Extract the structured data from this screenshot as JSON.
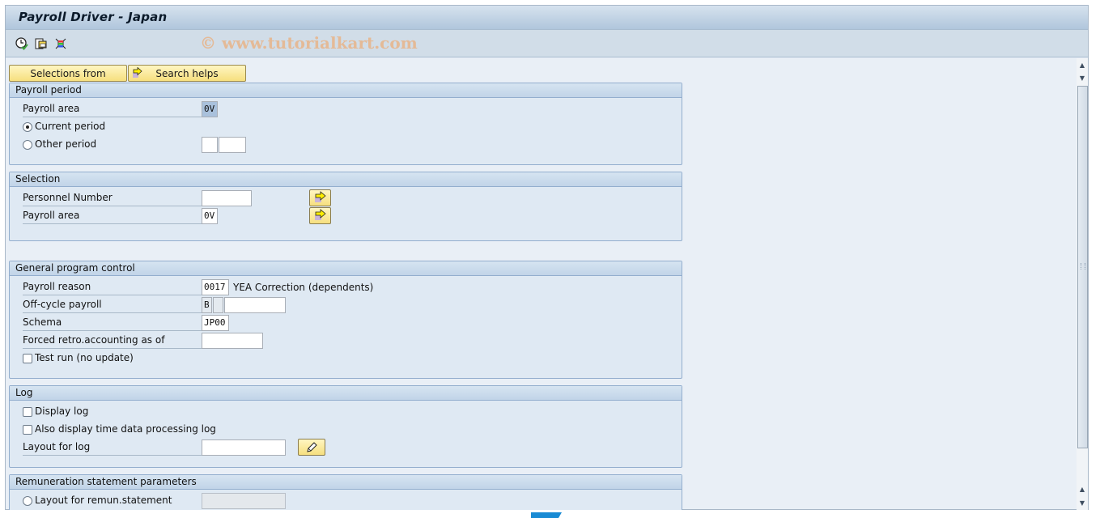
{
  "window": {
    "title": "Payroll Driver - Japan",
    "watermark": "© www.tutorialkart.com"
  },
  "toolbar": {
    "icons": [
      "execute-in-background-icon",
      "get-variant-icon",
      "selection-options-icon"
    ]
  },
  "buttons": {
    "selections_from": "Selections from",
    "search_helps": "Search helps"
  },
  "payroll_period": {
    "header": "Payroll period",
    "payroll_area_label": "Payroll area",
    "payroll_area_value": "0V",
    "current_period_label": "Current period",
    "current_period_selected": true,
    "other_period_label": "Other period",
    "other_period_selected": false,
    "other_period_value1": "",
    "other_period_value2": ""
  },
  "selection": {
    "header": "Selection",
    "personnel_number_label": "Personnel Number",
    "personnel_number_value": "",
    "payroll_area_label": "Payroll area",
    "payroll_area_value": "0V"
  },
  "general": {
    "header": "General program control",
    "payroll_reason_label": "Payroll reason",
    "payroll_reason_value": "0017",
    "payroll_reason_desc": "YEA Correction (dependents)",
    "offcycle_label": "Off-cycle payroll",
    "offcycle_value1": "B",
    "offcycle_value2": "",
    "offcycle_value3": "",
    "schema_label": "Schema",
    "schema_value": "JP00",
    "forced_retro_label": "Forced retro.accounting as of",
    "forced_retro_value": "",
    "test_run_label": "Test run (no update)",
    "test_run_checked": false
  },
  "log": {
    "header": "Log",
    "display_log_label": "Display log",
    "display_log_checked": false,
    "time_log_label": "Also display time data processing log",
    "time_log_checked": false,
    "layout_label": "Layout for log",
    "layout_value": ""
  },
  "remuneration": {
    "header": "Remuneration statement parameters",
    "layout_label": "Layout for remun.statement",
    "layout_selected": false,
    "layout_value": ""
  }
}
